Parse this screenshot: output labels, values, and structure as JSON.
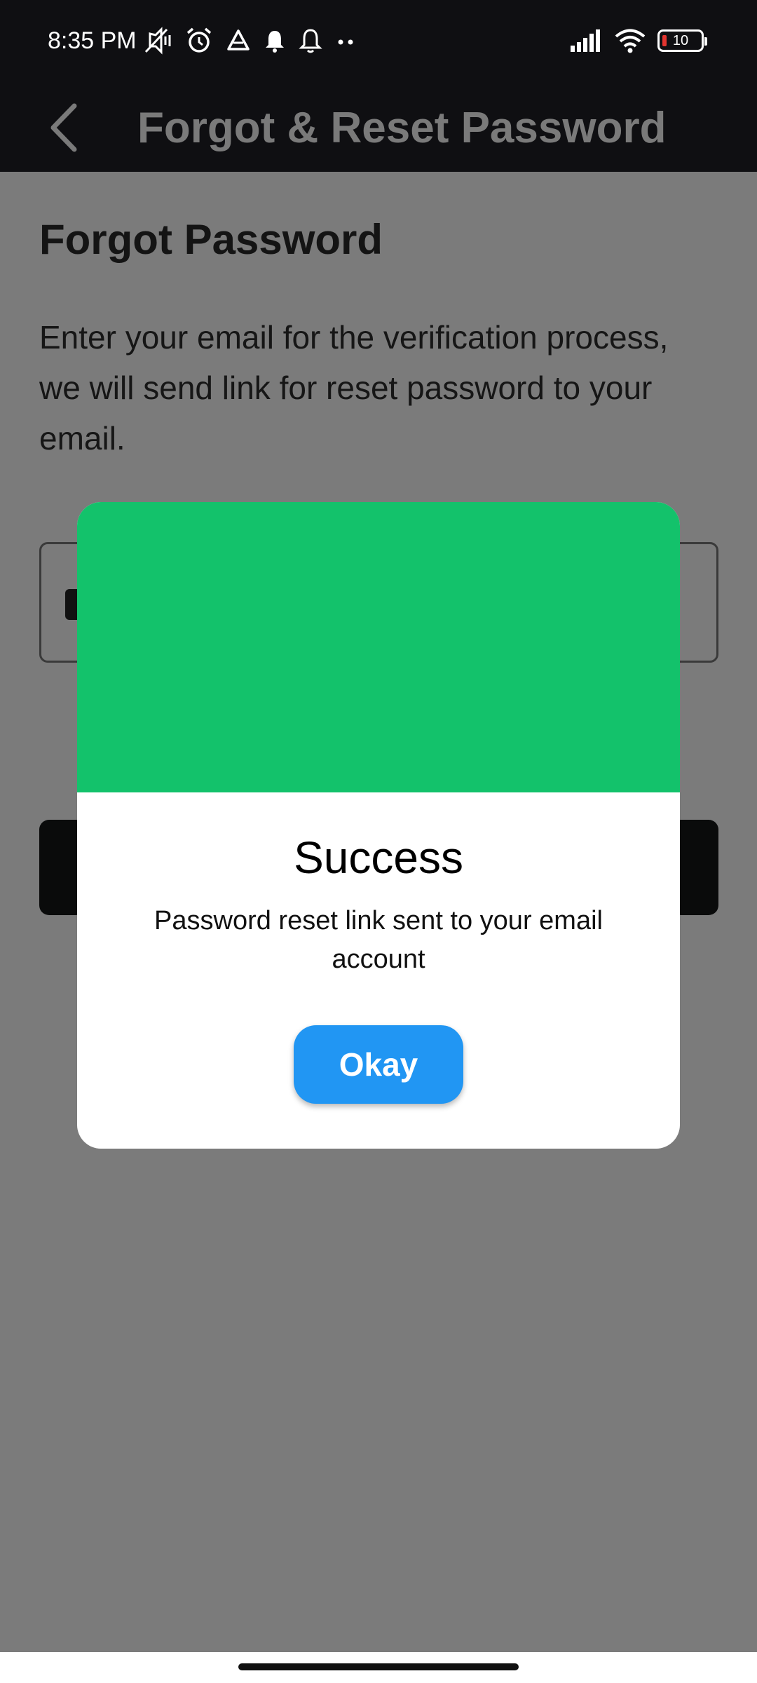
{
  "status_bar": {
    "time": "8:35 PM",
    "battery": "10",
    "icons": [
      "mute-vibrate-icon",
      "alarm-icon",
      "drive-icon",
      "notification-bell-icon",
      "notification-bell-outline-icon",
      "more-dots-icon",
      "signal-icon",
      "wifi-icon",
      "battery-icon"
    ]
  },
  "app_bar": {
    "title": "Forgot & Reset Password",
    "back_icon": "chevron-left-icon"
  },
  "page": {
    "heading": "Forgot Password",
    "description": "Enter your email for the verification process, we will send link for reset password to your email.",
    "email_icon": "mail-icon"
  },
  "dialog": {
    "title": "Success",
    "message": "Password reset link sent to your email account",
    "button_label": "Okay",
    "hero_color": "#13c26b",
    "button_color": "#2196f3"
  }
}
